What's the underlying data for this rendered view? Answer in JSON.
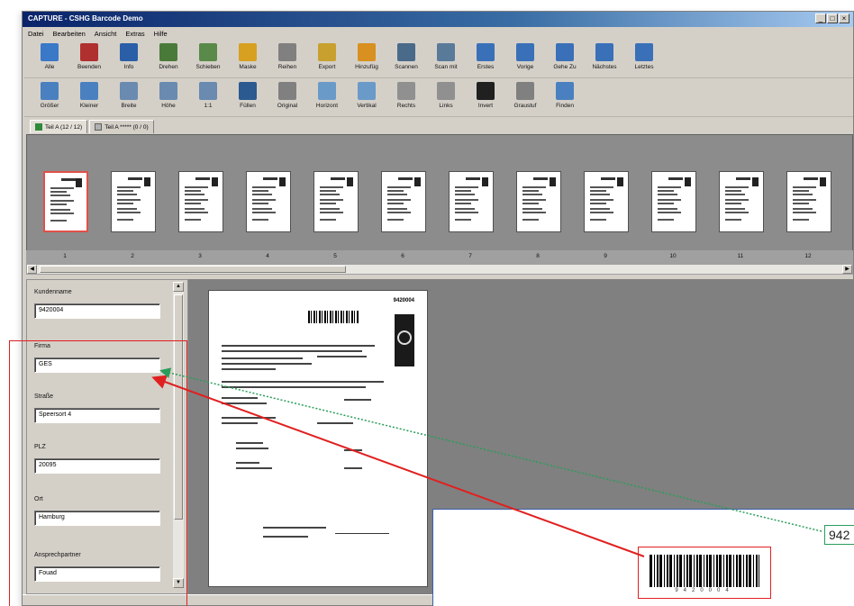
{
  "window": {
    "title": "CAPTURE - CSHG Barcode Demo",
    "controls": [
      "_",
      "□",
      "×"
    ]
  },
  "menu": [
    "Datei",
    "Bearbeiten",
    "Ansicht",
    "Extras",
    "Hilfe"
  ],
  "toolbar1": [
    {
      "label": "Alle",
      "icon": "select-all-icon",
      "color": "#3a78c8"
    },
    {
      "label": "Beenden",
      "icon": "exit-icon",
      "color": "#b03030"
    },
    {
      "label": "Info",
      "icon": "info-icon",
      "color": "#2a5fa8"
    },
    {
      "label": "Drehen",
      "icon": "rotate-icon",
      "color": "#4a7a3a"
    },
    {
      "label": "Schieben",
      "icon": "move-icon",
      "color": "#5a8a4a"
    },
    {
      "label": "Maske",
      "icon": "folder-icon",
      "color": "#d8a020"
    },
    {
      "label": "Reihen",
      "icon": "document-icon",
      "color": "#808080"
    },
    {
      "label": "Export",
      "icon": "export-icon",
      "color": "#c8a030"
    },
    {
      "label": "Hinzufüg",
      "icon": "add-icon",
      "color": "#d89020"
    },
    {
      "label": "Scannen",
      "icon": "scan-icon",
      "color": "#4a6a8a"
    },
    {
      "label": "Scan mit",
      "icon": "scan-with-icon",
      "color": "#5a7a9a"
    },
    {
      "label": "Erstes",
      "icon": "first-icon",
      "color": "#3a70b8"
    },
    {
      "label": "Vorige",
      "icon": "previous-icon",
      "color": "#3a70b8"
    },
    {
      "label": "Gehe Zu",
      "icon": "goto-icon",
      "color": "#3a70b8"
    },
    {
      "label": "Nächstes",
      "icon": "next-icon",
      "color": "#3a70b8"
    },
    {
      "label": "Letztes",
      "icon": "last-icon",
      "color": "#3a70b8"
    }
  ],
  "toolbar2": [
    {
      "label": "Größer",
      "icon": "zoom-in-icon",
      "color": "#4a80c0"
    },
    {
      "label": "Kleiner",
      "icon": "zoom-out-icon",
      "color": "#4a80c0"
    },
    {
      "label": "Breite",
      "icon": "fit-width-icon",
      "color": "#6a8ab0"
    },
    {
      "label": "Höhe",
      "icon": "fit-height-icon",
      "color": "#6a8ab0"
    },
    {
      "label": "1:1",
      "icon": "actual-size-icon",
      "color": "#6a8ab0"
    },
    {
      "label": "Füllen",
      "icon": "fill-icon",
      "color": "#2a5a90"
    },
    {
      "label": "Original",
      "icon": "original-icon",
      "color": "#808080"
    },
    {
      "label": "Horizont",
      "icon": "flip-horizontal-icon",
      "color": "#6a9ac8"
    },
    {
      "label": "Vertikal",
      "icon": "flip-vertical-icon",
      "color": "#6a9ac8"
    },
    {
      "label": "Rechts",
      "icon": "rotate-right-icon",
      "color": "#909090"
    },
    {
      "label": "Links",
      "icon": "rotate-left-icon",
      "color": "#909090"
    },
    {
      "label": "Invert",
      "icon": "invert-icon",
      "color": "#202020"
    },
    {
      "label": "Graustuf",
      "icon": "grayscale-icon",
      "color": "#808080"
    },
    {
      "label": "Finden",
      "icon": "find-icon",
      "color": "#4a80c0"
    }
  ],
  "tabs": [
    {
      "label": "Teil A (12 / 12)",
      "active": true
    },
    {
      "label": "Teil A ***** (0 / 0)",
      "active": false
    }
  ],
  "thumbnails": [
    "1",
    "2",
    "3",
    "4",
    "5",
    "6",
    "7",
    "8",
    "9",
    "10",
    "11",
    "12"
  ],
  "fields": [
    {
      "label": "Kundenname",
      "value": "9420004"
    },
    {
      "label": "Firma",
      "value": "GES"
    },
    {
      "label": "Straße",
      "value": "Speersort 4"
    },
    {
      "label": "PLZ",
      "value": "20095"
    },
    {
      "label": "Ort",
      "value": "Hamburg"
    },
    {
      "label": "Ansprechpartner",
      "value": "Fouad"
    }
  ],
  "document": {
    "id": "9420004"
  },
  "callout": {
    "barcode_digits": "9420004",
    "value_snippet": "942"
  },
  "colors": {
    "highlight_red": "#e02020",
    "arrow_green": "#2a9d5a",
    "zoom_border": "#3b5ea8"
  }
}
